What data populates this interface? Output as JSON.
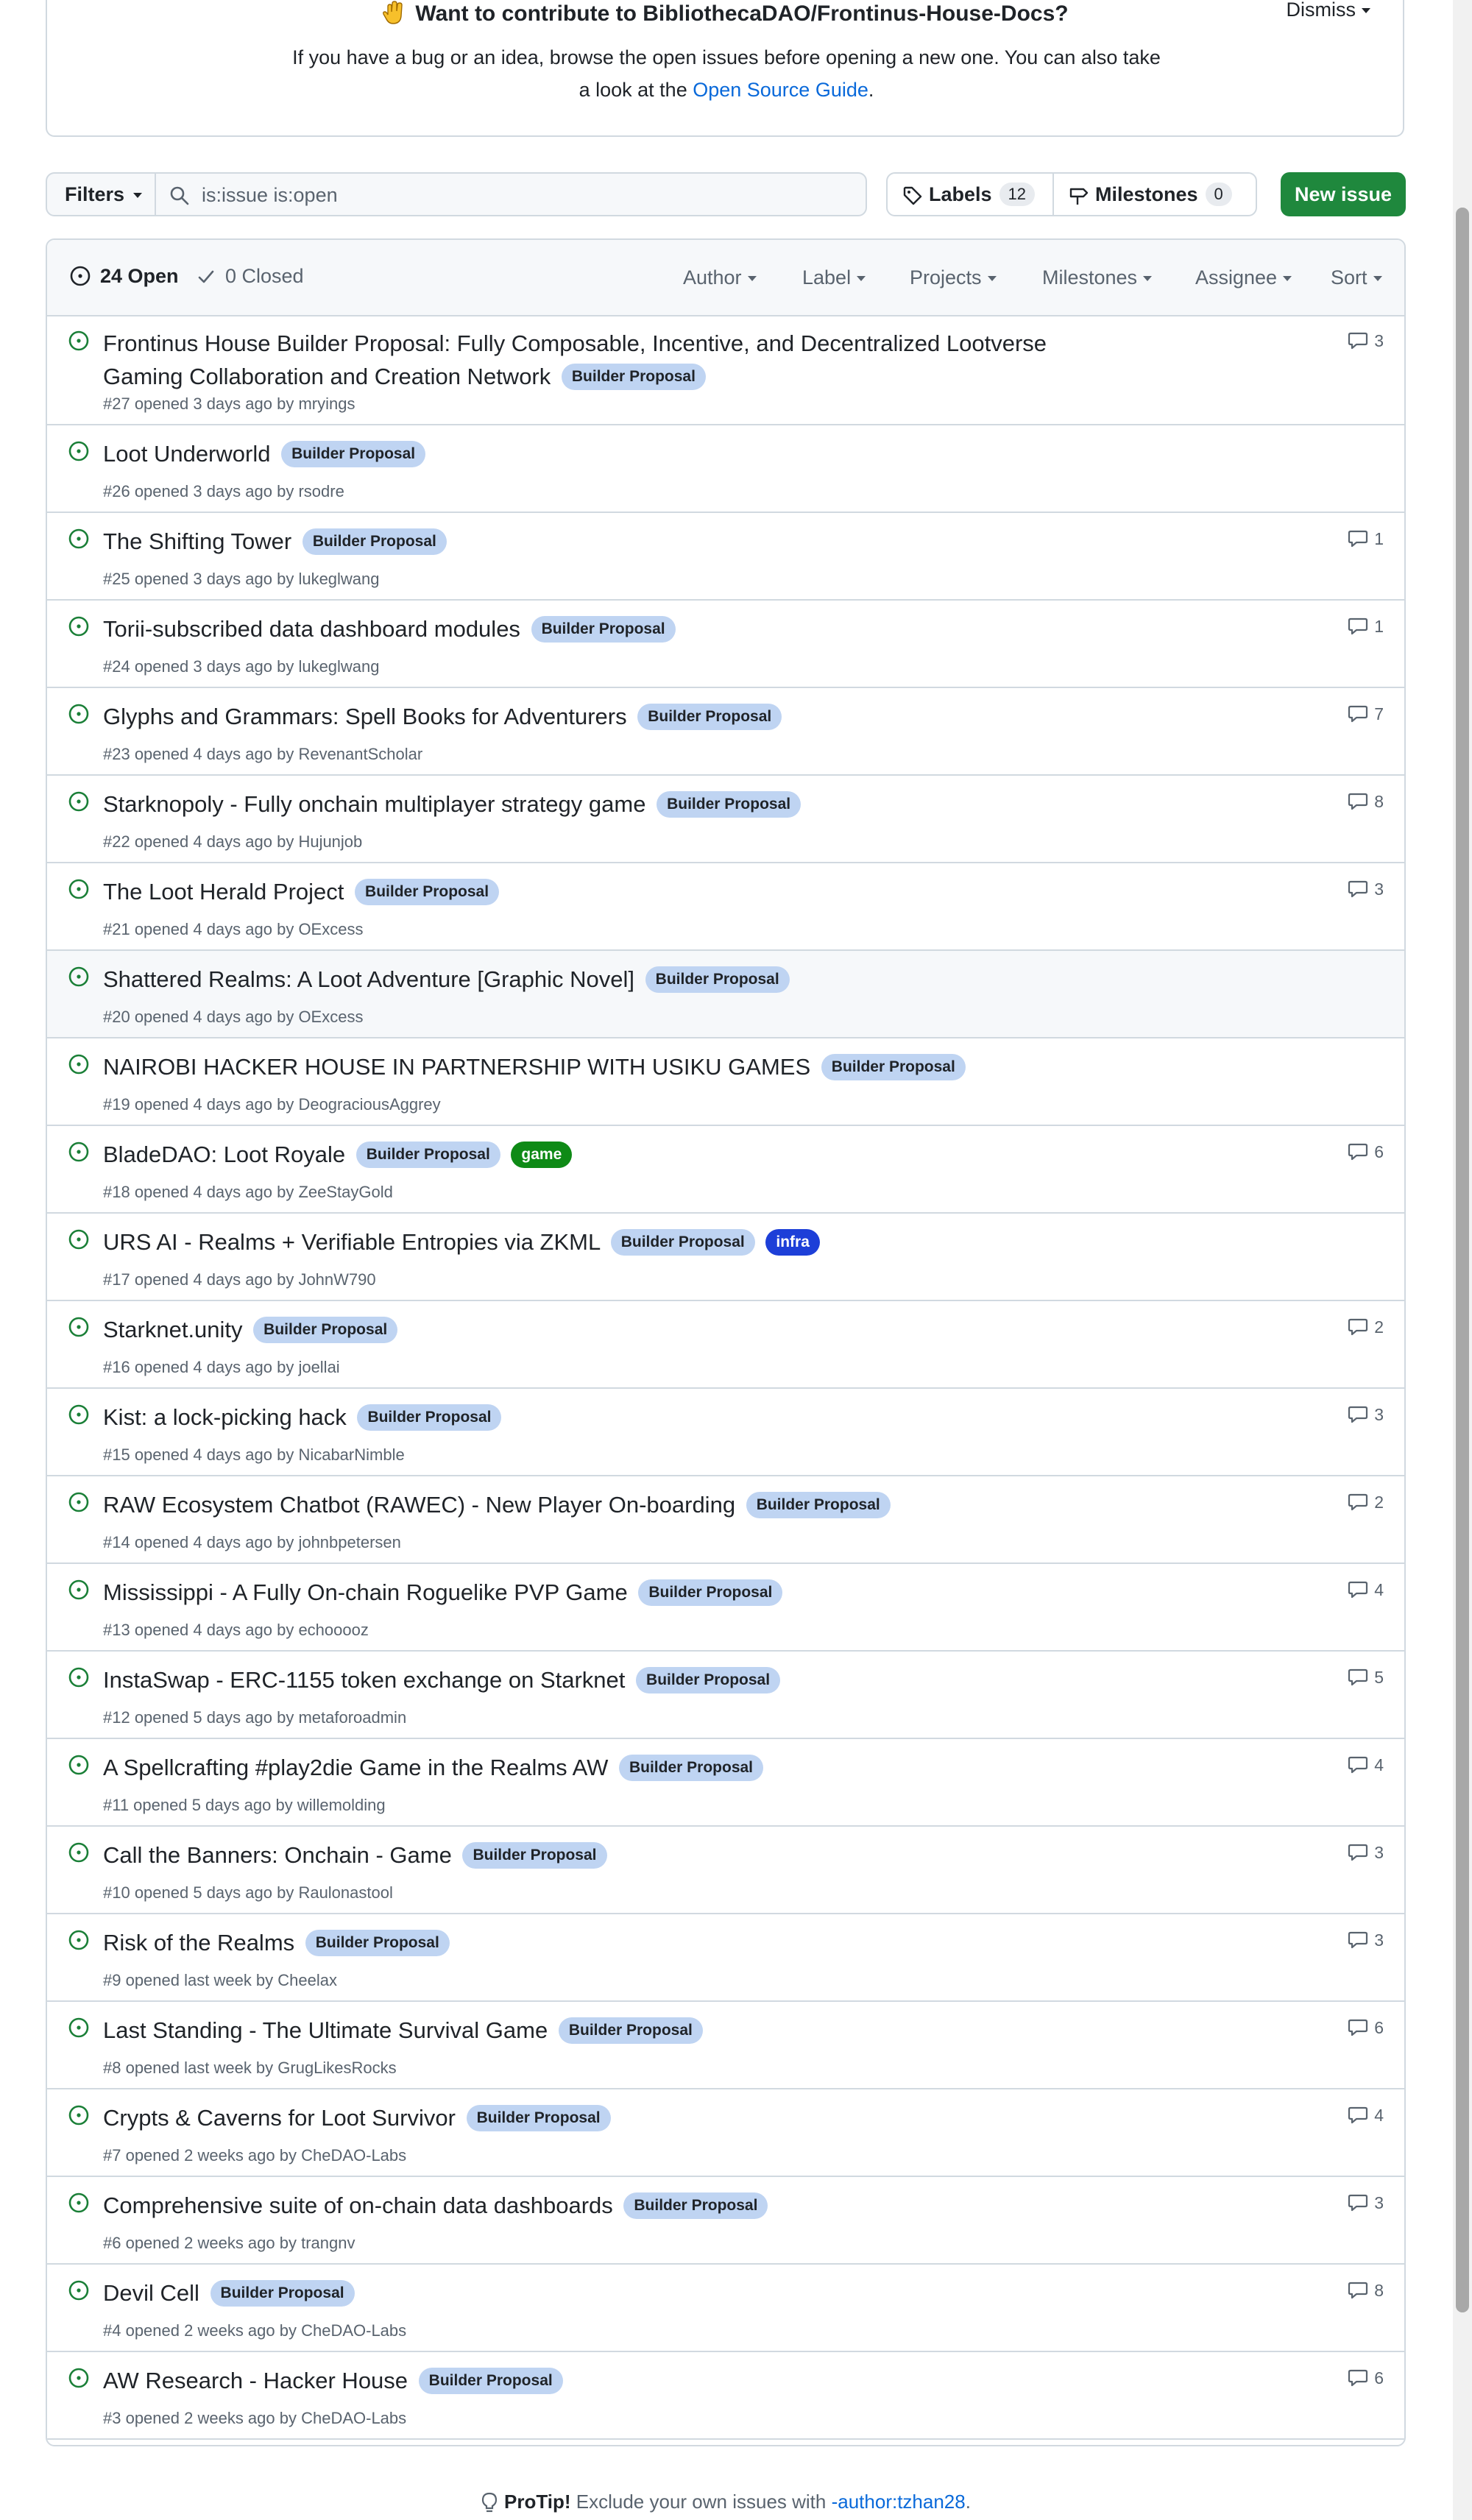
{
  "banner": {
    "title": "Want to contribute to BibliothecaDAO/Frontinus-House-Docs?",
    "text_before": "If you have a bug or an idea, browse the open issues before opening a new one. You can also take a look at the ",
    "link": "Open Source Guide",
    "text_after": ".",
    "dismiss": "Dismiss"
  },
  "toolbar": {
    "filters": "Filters",
    "search_value": "is:issue is:open",
    "labels": "Labels",
    "labels_count": "12",
    "milestones": "Milestones",
    "milestones_count": "0",
    "new_issue": "New issue"
  },
  "header": {
    "open": "24 Open",
    "closed": "0 Closed",
    "filters": [
      "Author",
      "Label",
      "Projects",
      "Milestones",
      "Assignee",
      "Sort"
    ]
  },
  "issues": [
    {
      "title": "Frontinus House Builder Proposal: Fully Composable, Incentive, and Decentralized Lootverse Gaming Collaboration and Creation Network",
      "labels": [
        "Builder Proposal"
      ],
      "meta": "#27 opened 3 days ago by mryings",
      "comments": "3"
    },
    {
      "title": "Loot Underworld",
      "labels": [
        "Builder Proposal"
      ],
      "meta": "#26 opened 3 days ago by rsodre",
      "comments": ""
    },
    {
      "title": "The Shifting Tower",
      "labels": [
        "Builder Proposal"
      ],
      "meta": "#25 opened 3 days ago by lukeglwang",
      "comments": "1"
    },
    {
      "title": "Torii-subscribed data dashboard modules",
      "labels": [
        "Builder Proposal"
      ],
      "meta": "#24 opened 3 days ago by lukeglwang",
      "comments": "1"
    },
    {
      "title": "Glyphs and Grammars: Spell Books for Adventurers",
      "labels": [
        "Builder Proposal"
      ],
      "meta": "#23 opened 4 days ago by RevenantScholar",
      "comments": "7"
    },
    {
      "title": "Starknopoly - Fully onchain multiplayer strategy game",
      "labels": [
        "Builder Proposal"
      ],
      "meta": "#22 opened 4 days ago by Hujunjob",
      "comments": "8"
    },
    {
      "title": "The Loot Herald Project",
      "labels": [
        "Builder Proposal"
      ],
      "meta": "#21 opened 4 days ago by OExcess",
      "comments": "3"
    },
    {
      "title": "Shattered Realms: A Loot Adventure [Graphic Novel]",
      "labels": [
        "Builder Proposal"
      ],
      "meta": "#20 opened 4 days ago by OExcess",
      "comments": ""
    },
    {
      "title": "NAIROBI HACKER HOUSE IN PARTNERSHIP WITH USIKU GAMES",
      "labels": [
        "Builder Proposal"
      ],
      "meta": "#19 opened 4 days ago by DeograciousAggrey",
      "comments": ""
    },
    {
      "title": "BladeDAO: Loot Royale",
      "labels": [
        "Builder Proposal",
        "game"
      ],
      "meta": "#18 opened 4 days ago by ZeeStayGold",
      "comments": "6"
    },
    {
      "title": "URS AI - Realms + Verifiable Entropies via ZKML",
      "labels": [
        "Builder Proposal",
        "infra"
      ],
      "meta": "#17 opened 4 days ago by JohnW790",
      "comments": ""
    },
    {
      "title": "Starknet.unity",
      "labels": [
        "Builder Proposal"
      ],
      "meta": "#16 opened 4 days ago by joellai",
      "comments": "2"
    },
    {
      "title": "Kist: a lock-picking hack",
      "labels": [
        "Builder Proposal"
      ],
      "meta": "#15 opened 4 days ago by NicabarNimble",
      "comments": "3"
    },
    {
      "title": "RAW Ecosystem Chatbot (RAWEC) - New Player On-boarding",
      "labels": [
        "Builder Proposal"
      ],
      "meta": "#14 opened 4 days ago by johnbpetersen",
      "comments": "2"
    },
    {
      "title": "Mississippi - A Fully On-chain Roguelike PVP Game",
      "labels": [
        "Builder Proposal"
      ],
      "meta": "#13 opened 4 days ago by echooooz",
      "comments": "4"
    },
    {
      "title": "InstaSwap - ERC-1155 token exchange on Starknet",
      "labels": [
        "Builder Proposal"
      ],
      "meta": "#12 opened 5 days ago by metaforoadmin",
      "comments": "5"
    },
    {
      "title": "A Spellcrafting #play2die Game in the Realms AW",
      "labels": [
        "Builder Proposal"
      ],
      "meta": "#11 opened 5 days ago by willemolding",
      "comments": "4"
    },
    {
      "title": "Call the Banners: Onchain - Game",
      "labels": [
        "Builder Proposal"
      ],
      "meta": "#10 opened 5 days ago by Raulonastool",
      "comments": "3"
    },
    {
      "title": "Risk of the Realms",
      "labels": [
        "Builder Proposal"
      ],
      "meta": "#9 opened last week by Cheelax",
      "comments": "3"
    },
    {
      "title": "Last Standing - The Ultimate Survival Game",
      "labels": [
        "Builder Proposal"
      ],
      "meta": "#8 opened last week by GrugLikesRocks",
      "comments": "6"
    },
    {
      "title": "Crypts & Caverns for Loot Survivor",
      "labels": [
        "Builder Proposal"
      ],
      "meta": "#7 opened 2 weeks ago by CheDAO-Labs",
      "comments": "4"
    },
    {
      "title": "Comprehensive suite of on-chain data dashboards",
      "labels": [
        "Builder Proposal"
      ],
      "meta": "#6 opened 2 weeks ago by trangnv",
      "comments": "3"
    },
    {
      "title": "Devil Cell",
      "labels": [
        "Builder Proposal"
      ],
      "meta": "#4 opened 2 weeks ago by CheDAO-Labs",
      "comments": "8"
    },
    {
      "title": "AW Research - Hacker House",
      "labels": [
        "Builder Proposal"
      ],
      "meta": "#3 opened 2 weeks ago by CheDAO-Labs",
      "comments": "6"
    }
  ],
  "label_colors": {
    "Builder Proposal": "#bfd4f2",
    "game": "#0e8a16",
    "infra": "#1d3fd8"
  },
  "protip": {
    "bold": "ProTip!",
    "text": " Exclude your own issues with ",
    "link": "-author:tzhan28",
    "end": "."
  }
}
